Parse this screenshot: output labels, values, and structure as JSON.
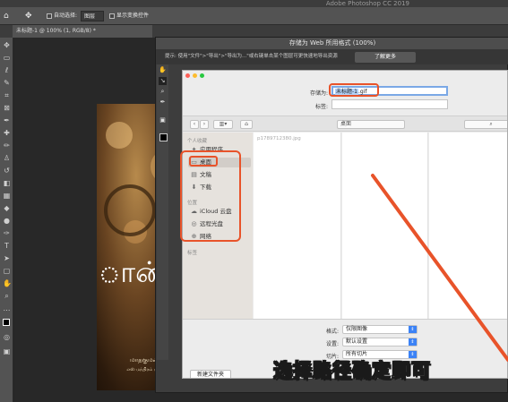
{
  "app": {
    "title": "Adobe Photoshop CC 2019"
  },
  "options_bar": {
    "auto_select_label": "自动选择:",
    "auto_select_value": "图层",
    "show_transform_label": "显示变换控件"
  },
  "document_tab": {
    "label": "未标题-1 @ 100% (1, RGB/8) *"
  },
  "artwork": {
    "script_text": "ான்",
    "line1": "மாதகுமணி",
    "line2": "எஸ் மந்திரம் மதுபி"
  },
  "save_for_web": {
    "title": "存储为 Web 所用格式 (100%)",
    "info_text": "提示: 使用\"文件\">\"导出\">\"导出为...\"或右键单击某个图层可更快速地导出资源",
    "learn_more_label": "了解更多"
  },
  "save_sheet": {
    "save_as_label": "存储为:",
    "filename_value": "未标题-1.gif",
    "filename_selected": "未标题-1",
    "filename_ext": ".gif",
    "tags_label": "标签:",
    "location_value": "桌面",
    "sidebar": {
      "favorites_header": "个人收藏",
      "items": [
        {
          "label": "应用程序",
          "icon": "apps-icon"
        },
        {
          "label": "桌面",
          "icon": "desktop-icon"
        },
        {
          "label": "文稿",
          "icon": "document-icon"
        },
        {
          "label": "下载",
          "icon": "download-icon"
        }
      ],
      "locations_header": "位置",
      "locations": [
        {
          "label": "iCloud 云盘",
          "icon": "cloud-icon"
        },
        {
          "label": "远程光盘",
          "icon": "disc-icon"
        },
        {
          "label": "网络",
          "icon": "network-icon"
        }
      ],
      "tags_header": "标签"
    },
    "file_list": [
      "p1789712380.jpg"
    ],
    "format_label": "格式:",
    "format_value": "仅限图像",
    "settings_label": "设置:",
    "settings_value": "默认设置",
    "slices_label": "切片:",
    "slices_value": "所有切片",
    "new_folder_label": "新建文件夹"
  },
  "caption": "选择路径确定即可",
  "colors": {
    "annotation": "#e8532a",
    "selection_blue": "#3b82f6"
  }
}
